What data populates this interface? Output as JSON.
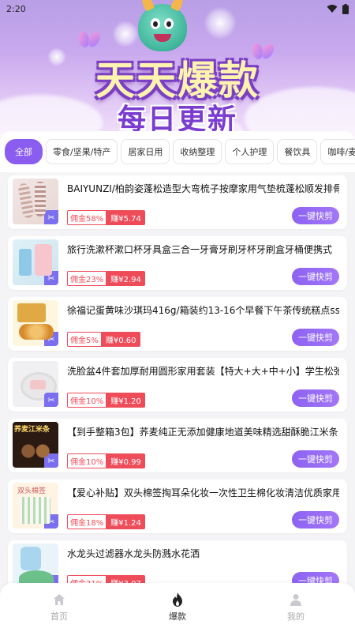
{
  "status_bar": {
    "time": "2:20"
  },
  "banner": {
    "headline_1": "天天爆款",
    "headline_2": "每日更新"
  },
  "tabs": [
    {
      "label": "全部",
      "active": true
    },
    {
      "label": "零食/坚果/特产",
      "active": false
    },
    {
      "label": "居家日用",
      "active": false
    },
    {
      "label": "收纳整理",
      "active": false
    },
    {
      "label": "个人护理",
      "active": false
    },
    {
      "label": "餐饮具",
      "active": false
    },
    {
      "label": "咖啡/麦片/冲",
      "active": false
    }
  ],
  "products": [
    {
      "title": "BAIYUNZI/柏韵姿蓬松造型大弯梳子按摩家用气垫梳蓬松顺发排骨梳",
      "commission": "佣金58%",
      "earn": "赚¥5.74",
      "button": "一键快剪"
    },
    {
      "title": "旅行洗漱杯漱口杯牙具盒三合一牙膏牙刷牙杯牙刷盒牙桶便携式",
      "commission": "佣金23%",
      "earn": "赚¥2.94",
      "button": "一键快剪"
    },
    {
      "title": "徐福记蛋黄味沙琪玛416g/箱装约13-16个早餐下午茶传统糕点sss",
      "commission": "佣金5%",
      "earn": "赚¥0.60",
      "button": "一键快剪"
    },
    {
      "title": "洗脸盆4件套加厚耐用圆形家用套装【特大+大+中+小】学生松弛感",
      "commission": "佣金10%",
      "earn": "赚¥1.20",
      "button": "一键快剪"
    },
    {
      "title": "【到手整箱3包】荞麦纯正无添加健康地道美味精选甜酥脆江米条",
      "commission": "佣金10%",
      "earn": "赚¥0.99",
      "button": "一键快剪"
    },
    {
      "title": "【爱心补贴】双头棉签掏耳朵化妆一次性卫生棉化妆清洁优质家用白色",
      "commission": "佣金18%",
      "earn": "赚¥1.24",
      "button": "一键快剪"
    },
    {
      "title": "水龙头过滤器水龙头防溅水花洒",
      "commission": "佣金31%",
      "earn": "赚¥3.07",
      "button": "一键快剪"
    }
  ],
  "bottom_nav": [
    {
      "label": "首页",
      "icon": "home-icon",
      "active": false
    },
    {
      "label": "爆款",
      "icon": "flame-icon",
      "active": true
    },
    {
      "label": "我的",
      "icon": "person-icon",
      "active": false
    }
  ],
  "colors": {
    "accent": "#8a5cf0",
    "commission_red": "#ef4c5a"
  }
}
